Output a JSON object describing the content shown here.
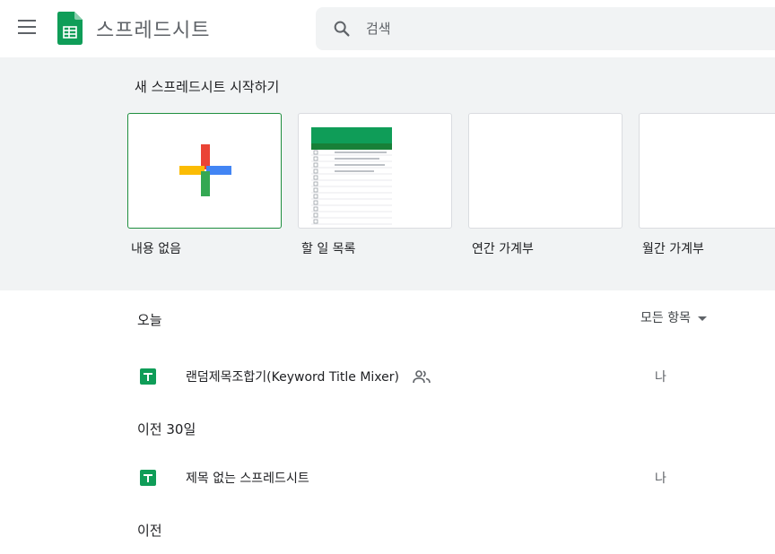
{
  "header": {
    "app_title": "스프레드시트",
    "search_placeholder": "검색"
  },
  "gallery": {
    "title": "새 스프레드시트 시작하기",
    "templates": [
      {
        "label": "내용 없음"
      },
      {
        "label": "할 일 목록"
      },
      {
        "label": "연간 가계부"
      },
      {
        "label": "월간 가계부"
      }
    ]
  },
  "files": {
    "owner_filter": "모든 항목",
    "sections": [
      {
        "title": "오늘",
        "items": [
          {
            "name": "랜덤제목조합기(Keyword Title Mixer)",
            "owner": "나",
            "shared": true
          }
        ]
      },
      {
        "title": "이전 30일",
        "items": [
          {
            "name": "제목 없는 스프레드시트",
            "owner": "나",
            "shared": false
          }
        ]
      },
      {
        "title": "이전",
        "items": []
      }
    ]
  },
  "colors": {
    "sheets_green": "#0f9d58",
    "plus_red": "#ea4335",
    "plus_blue": "#4285f4",
    "plus_yellow": "#fbbc04",
    "plus_green": "#34a853"
  }
}
